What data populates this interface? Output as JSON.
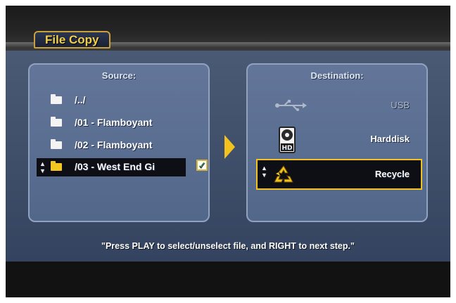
{
  "title": "File Copy",
  "source": {
    "header": "Source:",
    "items": [
      {
        "label": "/../",
        "icon": "folder-icon",
        "selected": false
      },
      {
        "label": "/01 - Flamboyant",
        "icon": "folder-icon",
        "selected": false
      },
      {
        "label": "/02 - Flamboyant",
        "icon": "folder-icon",
        "selected": false
      },
      {
        "label": "/03 - West End Gi",
        "icon": "folder-icon",
        "selected": true,
        "checked": true
      }
    ]
  },
  "check_mark": "✓",
  "destination": {
    "header": "Destination:",
    "items": [
      {
        "label": "USB",
        "icon": "usb-icon",
        "enabled": false
      },
      {
        "label": "Harddisk",
        "icon": "harddisk-icon",
        "enabled": true
      },
      {
        "label": "Recycle",
        "icon": "recycle-icon",
        "enabled": true,
        "selected": true
      }
    ]
  },
  "updown_glyphs": {
    "up": "▲",
    "down": "▼"
  },
  "hint": "\"Press PLAY to select/unselect file, and RIGHT to next step.\"",
  "colors": {
    "accent": "#f2c21f",
    "panel": "#4a5a75",
    "pane": "#5d7094",
    "selection": "#0d0f14"
  }
}
